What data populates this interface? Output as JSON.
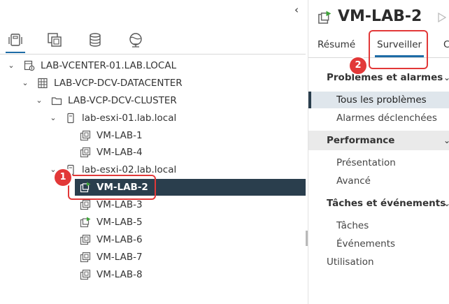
{
  "navigator": {
    "collapse_glyph": "‹",
    "icons": [
      "hosts-clusters-icon",
      "vms-templates-icon",
      "storage-icon",
      "networking-icon"
    ],
    "tree": [
      {
        "label": "LAB-VCENTER-01.LAB.LOCAL",
        "icon": "vcenter-icon",
        "caret": "⌄"
      },
      {
        "label": "LAB-VCP-DCV-DATACENTER",
        "icon": "datacenter-icon",
        "caret": "⌄"
      },
      {
        "label": "LAB-VCP-DCV-CLUSTER",
        "icon": "cluster-icon",
        "caret": "⌄"
      },
      {
        "label": "lab-esxi-01.lab.local",
        "icon": "host-icon",
        "caret": "⌄"
      },
      {
        "label": "VM-LAB-1",
        "icon": "vm-icon"
      },
      {
        "label": "VM-LAB-4",
        "icon": "vm-icon"
      },
      {
        "label": "lab-esxi-02.lab.local",
        "icon": "host-icon",
        "caret": "⌄"
      },
      {
        "label": "VM-LAB-2",
        "icon": "vm-running-icon",
        "selected": true
      },
      {
        "label": "VM-LAB-3",
        "icon": "vm-icon"
      },
      {
        "label": "VM-LAB-5",
        "icon": "vm-running-icon"
      },
      {
        "label": "VM-LAB-6",
        "icon": "vm-icon"
      },
      {
        "label": "VM-LAB-7",
        "icon": "vm-icon"
      },
      {
        "label": "VM-LAB-8",
        "icon": "vm-icon"
      }
    ]
  },
  "object": {
    "title": "VM-LAB-2",
    "tabs": [
      "Résumé",
      "Surveiller",
      "C"
    ],
    "active_tab": "Surveiller"
  },
  "monitor_menu": {
    "sections": [
      {
        "label": "Problèmes et alarmes",
        "items": [
          "Tous les problèmes",
          "Alarmes déclenchées"
        ],
        "active_item": "Tous les problèmes"
      },
      {
        "label": "Performance",
        "items": [
          "Présentation",
          "Avancé"
        ]
      },
      {
        "label": "Tâches et événements",
        "items": [
          "Tâches",
          "Événements"
        ]
      }
    ],
    "trailing_item": "Utilisation",
    "chevron": "⌄"
  },
  "callouts": [
    {
      "number": "1",
      "target": "VM-LAB-2 tree row"
    },
    {
      "number": "2",
      "target": "Surveiller tab"
    }
  ],
  "colors": {
    "accent": "#1d6ba6",
    "selection": "#2a3e4d",
    "callout": "#e23838",
    "vm_running": "#3fa33a"
  }
}
